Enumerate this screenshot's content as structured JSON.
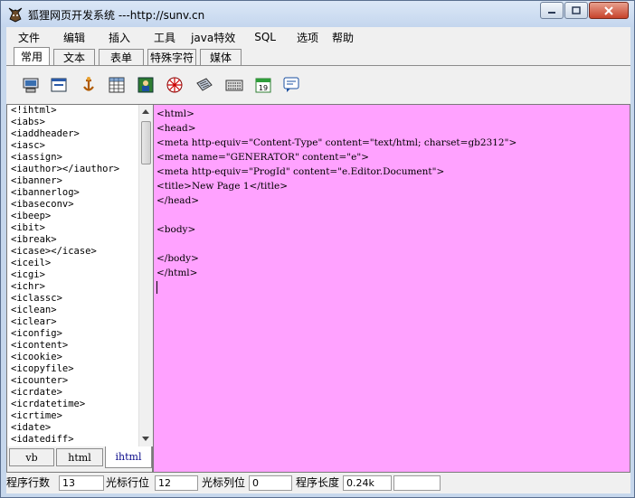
{
  "window": {
    "title": "狐狸网页开发系统 ---http://sunv.cn"
  },
  "menu": [
    "文件",
    "编辑",
    "插入",
    "工具",
    "java特效",
    "SQL",
    "选项",
    "帮助"
  ],
  "tabs": [
    {
      "label": "常用",
      "active": true
    },
    {
      "label": "文本",
      "active": false
    },
    {
      "label": "表单",
      "active": false
    },
    {
      "label": "特殊字符",
      "active": false
    },
    {
      "label": "媒体",
      "active": false
    }
  ],
  "toolbar_icons": [
    "computer-icon",
    "window-icon",
    "anchor-icon",
    "table-icon",
    "image-icon",
    "media-icon",
    "link-icon",
    "keyboard-icon",
    "calendar-icon",
    "comment-icon"
  ],
  "calendar_day": "19",
  "tag_list": [
    "<!ihtml>",
    "<iabs>",
    "<iaddheader>",
    "<iasc>",
    "<iassign>",
    "<iauthor></iauthor>",
    "<ibanner>",
    "<ibannerlog>",
    "<ibaseconv>",
    "<ibeep>",
    "<ibit>",
    "<ibreak>",
    "<icase></icase>",
    "<iceil>",
    "<icgi>",
    "<ichr>",
    "<iclassc>",
    "<iclean>",
    "<iclear>",
    "<iconfig>",
    "<icontent>",
    "<icookie>",
    "<icopyfile>",
    "<icounter>",
    "<icrdate>",
    "<icrdatetime>",
    "<icrtime>",
    "<idate>",
    "<idatediff>"
  ],
  "left_tabs": [
    {
      "label": "vb",
      "active": false
    },
    {
      "label": "html",
      "active": false
    },
    {
      "label": "ihtml",
      "active": true
    }
  ],
  "code_lines": [
    "<html>",
    "<head>",
    "<meta http-equiv=\"Content-Type\" content=\"text/html; charset=gb2312\">",
    "<meta name=\"GENERATOR\" content=\"e\">",
    "<meta http-equiv=\"ProgId\" content=\"e.Editor.Document\">",
    "<title>New Page 1</title>",
    "</head>",
    "",
    "<body>",
    "",
    "</body>",
    "</html>"
  ],
  "status": {
    "row_label": "程序行数",
    "row_value": "13",
    "cursor_row_label": "光标行位",
    "cursor_row_value": "12",
    "cursor_col_label": "光标列位",
    "cursor_col_value": "0",
    "length_label": "程序长度",
    "length_value": "0.24k"
  },
  "colors": {
    "editor_bg": "#ffa2ff",
    "frame": "#c6d7ec"
  }
}
